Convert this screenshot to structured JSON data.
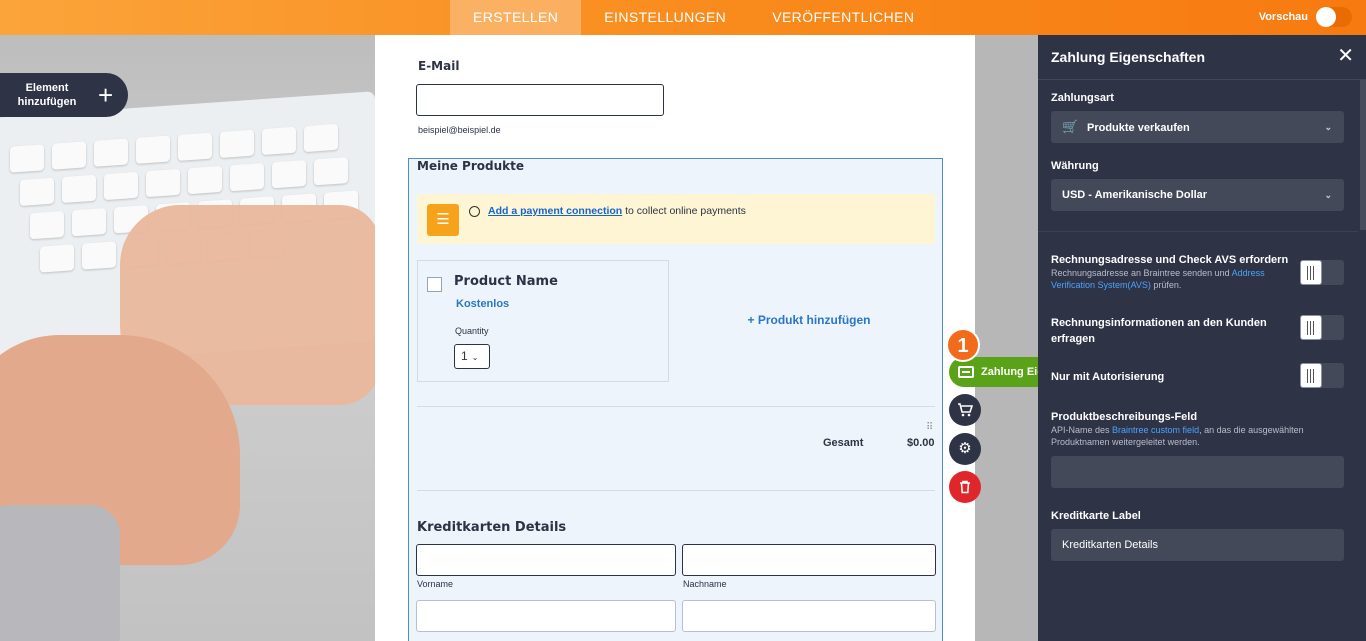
{
  "topbar": {
    "tabs": [
      {
        "label": "ERSTELLEN",
        "active": true
      },
      {
        "label": "EINSTELLUNGEN",
        "active": false
      },
      {
        "label": "VERÖFFENTLICHEN",
        "active": false
      }
    ],
    "preview_label": "Vorschau",
    "preview_on": false
  },
  "sidebar": {
    "add_element_label": "Element hinzufügen",
    "add_icon": "plus-icon"
  },
  "form": {
    "email": {
      "label": "E-Mail",
      "value": "",
      "sublabel": "beispiel@beispiel.de"
    },
    "payment": {
      "title": "Meine Produkte",
      "notice_link": "Add a payment connection",
      "notice_text": " to collect online payments",
      "product": {
        "name": "Product Name",
        "price": "Kostenlos",
        "qty_label": "Quantity",
        "qty_value": "1"
      },
      "add_product": "+ Produkt hinzufügen",
      "total_label": "Gesamt",
      "total_value": "$0.00",
      "cc_title": "Kreditkarten Details",
      "first_name_label": "Vorname",
      "last_name_label": "Nachname"
    }
  },
  "element_tools": {
    "step_badge": "1",
    "tag_label": "Zahlung Eig",
    "tools": [
      "cart-icon",
      "gear-icon",
      "trash-icon"
    ]
  },
  "panel": {
    "title": "Zahlung Eigenschaften",
    "payment_type_label": "Zahlungsart",
    "payment_type_value": "Produkte verkaufen",
    "currency_label": "Währung",
    "currency_value": "USD - Amerikanische Dollar",
    "avs": {
      "label": "Rechnungsadresse und Check AVS erfordern",
      "desc_pre": "Rechnungsadresse an Braintree senden und ",
      "desc_link": "Address Verification System(AVS)",
      "desc_post": " prüfen."
    },
    "billing_info_label": "Rechnungsinformationen an den Kunden erfragen",
    "auth_only_label": "Nur mit Autorisierung",
    "product_desc": {
      "label": "Produktbeschreibungs-Feld",
      "desc_pre": "API-Name des ",
      "desc_link": "Braintree custom field",
      "desc_post": ", an das die ausgewählten Produktnamen weitergeleitet werden.",
      "value": ""
    },
    "cc_label_title": "Kreditkarte Label",
    "cc_label_value": "Kreditkarten Details"
  },
  "colors": {
    "accent": "#f98a1c",
    "panel_bg": "#2f3346",
    "link": "#2a76c8",
    "tag_green": "#5aa217",
    "delete_red": "#e0262b"
  }
}
